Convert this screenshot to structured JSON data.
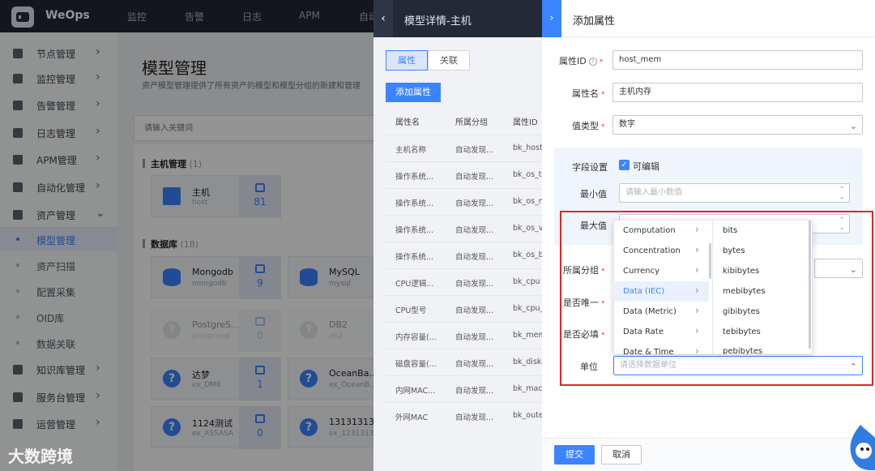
{
  "app": {
    "brand": "WeOps"
  },
  "topnav": [
    "监控",
    "告警",
    "日志",
    "APM",
    "自动"
  ],
  "sidebar": {
    "items": [
      {
        "label": "节点管理",
        "icon": "nodes-icon"
      },
      {
        "label": "监控管理",
        "icon": "monitor-icon"
      },
      {
        "label": "告警管理",
        "icon": "alert-icon"
      },
      {
        "label": "日志管理",
        "icon": "log-icon"
      },
      {
        "label": "APM管理",
        "icon": "apm-icon"
      },
      {
        "label": "自动化管理",
        "icon": "automation-icon"
      },
      {
        "label": "资产管理",
        "icon": "asset-icon"
      }
    ],
    "sub_items": [
      "模型管理",
      "资产扫描",
      "配置采集",
      "OID库",
      "数据关联"
    ],
    "items_after": [
      {
        "label": "知识库管理",
        "icon": "knowledge-icon"
      },
      {
        "label": "服务台管理",
        "icon": "service-desk-icon"
      },
      {
        "label": "运营管理",
        "icon": "operations-icon"
      }
    ]
  },
  "main": {
    "title": "模型管理",
    "description": "资产模型管理提供了所有资产的模型和模型分组的新建和管理",
    "search_placeholder": "请输入关键词",
    "groups": [
      {
        "name": "主机管理",
        "count": "(1)"
      },
      {
        "name": "数据库",
        "count": "(18)"
      }
    ],
    "models": [
      {
        "name": "主机",
        "id": "host",
        "count": "81"
      },
      {
        "name": "Mongodb",
        "id": "mongodb",
        "count": "9"
      },
      {
        "name": "MySQL",
        "id": "mysql",
        "count": ""
      },
      {
        "name": "PostgreS...",
        "id": "postgresql",
        "count": "0"
      },
      {
        "name": "DB2",
        "id": "db2",
        "count": ""
      },
      {
        "name": "达梦",
        "id": "ex_DM8",
        "count": "1"
      },
      {
        "name": "OceanBa...",
        "id": "ex_OceanB...",
        "count": ""
      },
      {
        "name": "1124测试",
        "id": "ex_ASSASA",
        "count": "0"
      },
      {
        "name": "13131313",
        "id": "ex_1231313",
        "count": ""
      }
    ]
  },
  "detail": {
    "title": "模型详情-主机",
    "tabs": [
      "属性",
      "关联"
    ],
    "add_button": "添加属性",
    "columns": [
      "属性名",
      "所属分组",
      "属性ID"
    ],
    "rows": [
      [
        "主机名称",
        "自动发现...",
        "bk_host"
      ],
      [
        "操作系统...",
        "自动发现...",
        "bk_os_ty"
      ],
      [
        "操作系统...",
        "自动发现...",
        "bk_os_n"
      ],
      [
        "操作系统...",
        "自动发现...",
        "bk_os_ve"
      ],
      [
        "操作系统...",
        "自动发现...",
        "bk_os_b"
      ],
      [
        "CPU逻辑...",
        "自动发现...",
        "bk_cpu"
      ],
      [
        "CPU型号",
        "自动发现...",
        "bk_cpu_"
      ],
      [
        "内存容量(...",
        "自动发现...",
        "bk_mem"
      ],
      [
        "磁盘容量(...",
        "自动发现...",
        "bk_disk"
      ],
      [
        "内网MAC...",
        "自动发现...",
        "bk_mac"
      ],
      [
        "外网MAC",
        "自动发现...",
        "bk_oute"
      ]
    ]
  },
  "form": {
    "title": "添加属性",
    "attr_id_label": "属性ID",
    "attr_id_value": "host_mem",
    "attr_name_label": "属性名",
    "attr_name_value": "主机内存",
    "value_type_label": "值类型",
    "value_type_value": "数字",
    "field_settings_label": "字段设置",
    "editable_label": "可编辑",
    "min_label": "最小值",
    "min_placeholder": "请输入最小数值",
    "max_label": "最大值",
    "group_label": "所属分组",
    "unique_label": "是否唯一",
    "required_label": "是否必填",
    "unit_label": "单位",
    "unit_placeholder": "请选择数据单位",
    "submit": "提交",
    "cancel": "取消",
    "required_mark": "*"
  },
  "unit_cascader": {
    "categories": [
      "Computation",
      "Concentration",
      "Currency",
      "Data (IEC)",
      "Data (Metric)",
      "Data Rate",
      "Date & Time"
    ],
    "active_category": "Data (IEC)",
    "units": [
      "bits",
      "bytes",
      "kibibytes",
      "mebibytes",
      "gibibytes",
      "tebibytes",
      "pebibytes"
    ]
  },
  "watermark": "大数跨境",
  "colors": {
    "primary": "#3a84ff",
    "highlight_border": "#e52424",
    "topbar": "#222733"
  }
}
